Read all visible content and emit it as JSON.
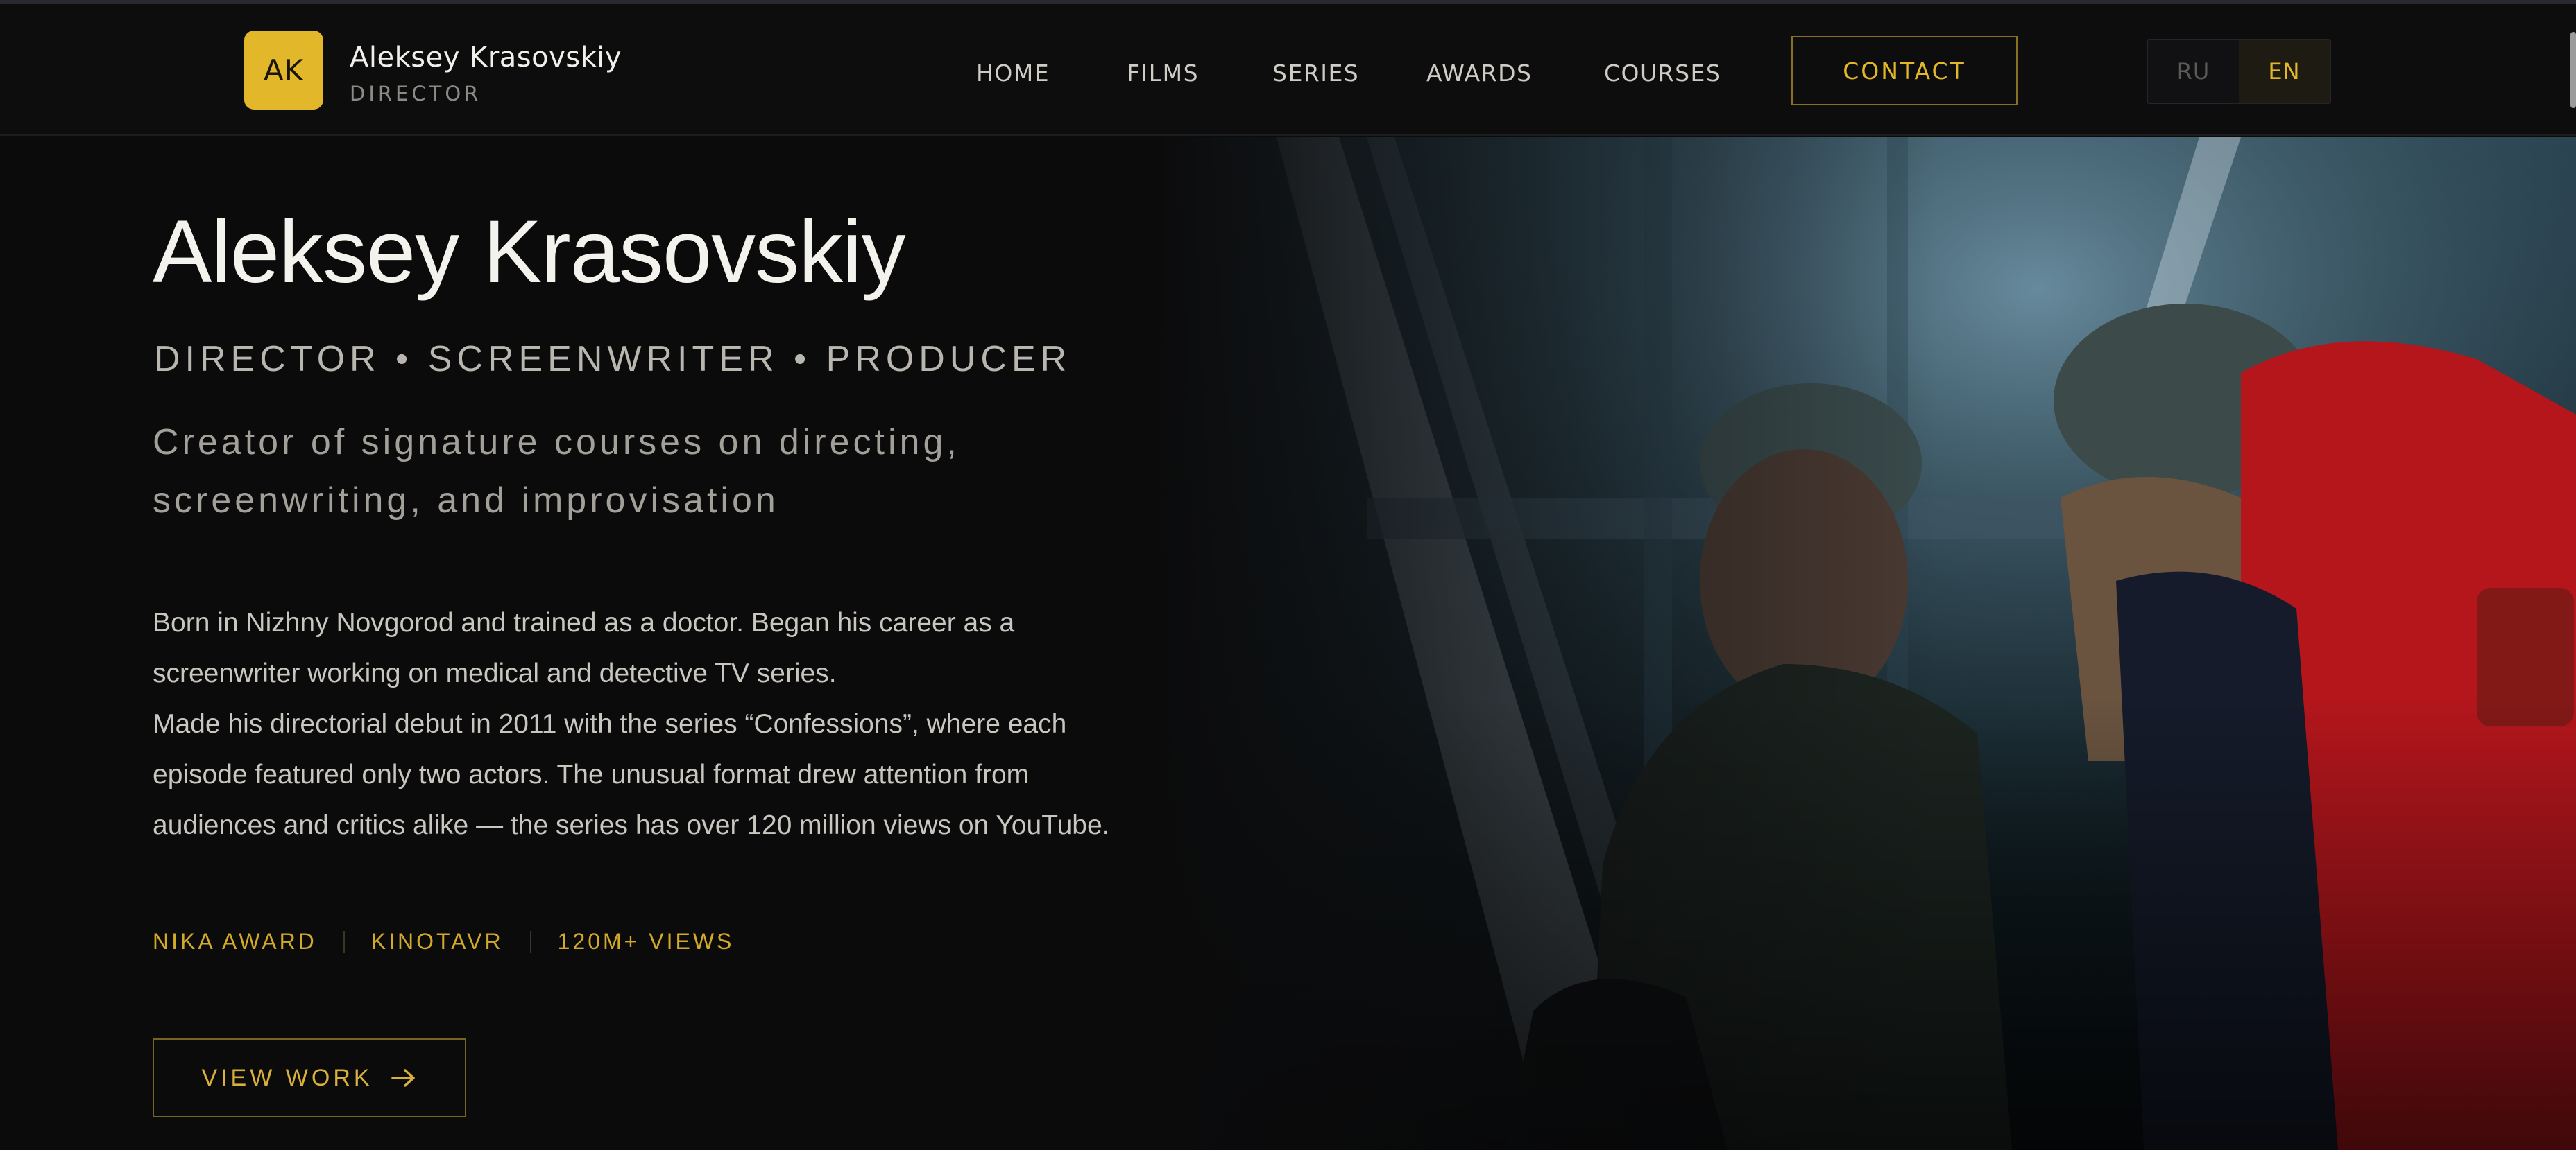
{
  "header": {
    "logo_initials": "AK",
    "brand_name": "Aleksey Krasovskiy",
    "brand_role": "DIRECTOR",
    "nav": [
      "HOME",
      "FILMS",
      "SERIES",
      "AWARDS",
      "COURSES"
    ],
    "contact_label": "CONTACT",
    "languages": [
      "RU",
      "EN"
    ],
    "active_language": "EN"
  },
  "hero": {
    "title": "Aleksey Krasovskiy",
    "roles": "DIRECTOR • SCREENWRITER • PRODUCER",
    "tagline_line1": "Creator of signature courses on directing,",
    "tagline_line2": "screenwriting, and improvisation",
    "bio_lines": [
      "Born in Nizhny Novgorod and trained as a doctor. Began his career as a",
      "screenwriter working on medical and detective TV series.",
      "Made his directorial debut in 2011 with the series “Confessions”, where each",
      "episode featured only two actors. The unusual format drew attention from",
      "audiences and critics alike — the series has over 120 million views on YouTube."
    ],
    "tags": [
      "NIKA AWARD",
      "KINOTAVR",
      "120M+ VIEWS"
    ],
    "cta_label": "VIEW WORK"
  },
  "theme": {
    "accent": "#e2b72a",
    "background": "#0b0b0c"
  },
  "icons": {
    "cta_icon": "arrow-right-icon"
  }
}
